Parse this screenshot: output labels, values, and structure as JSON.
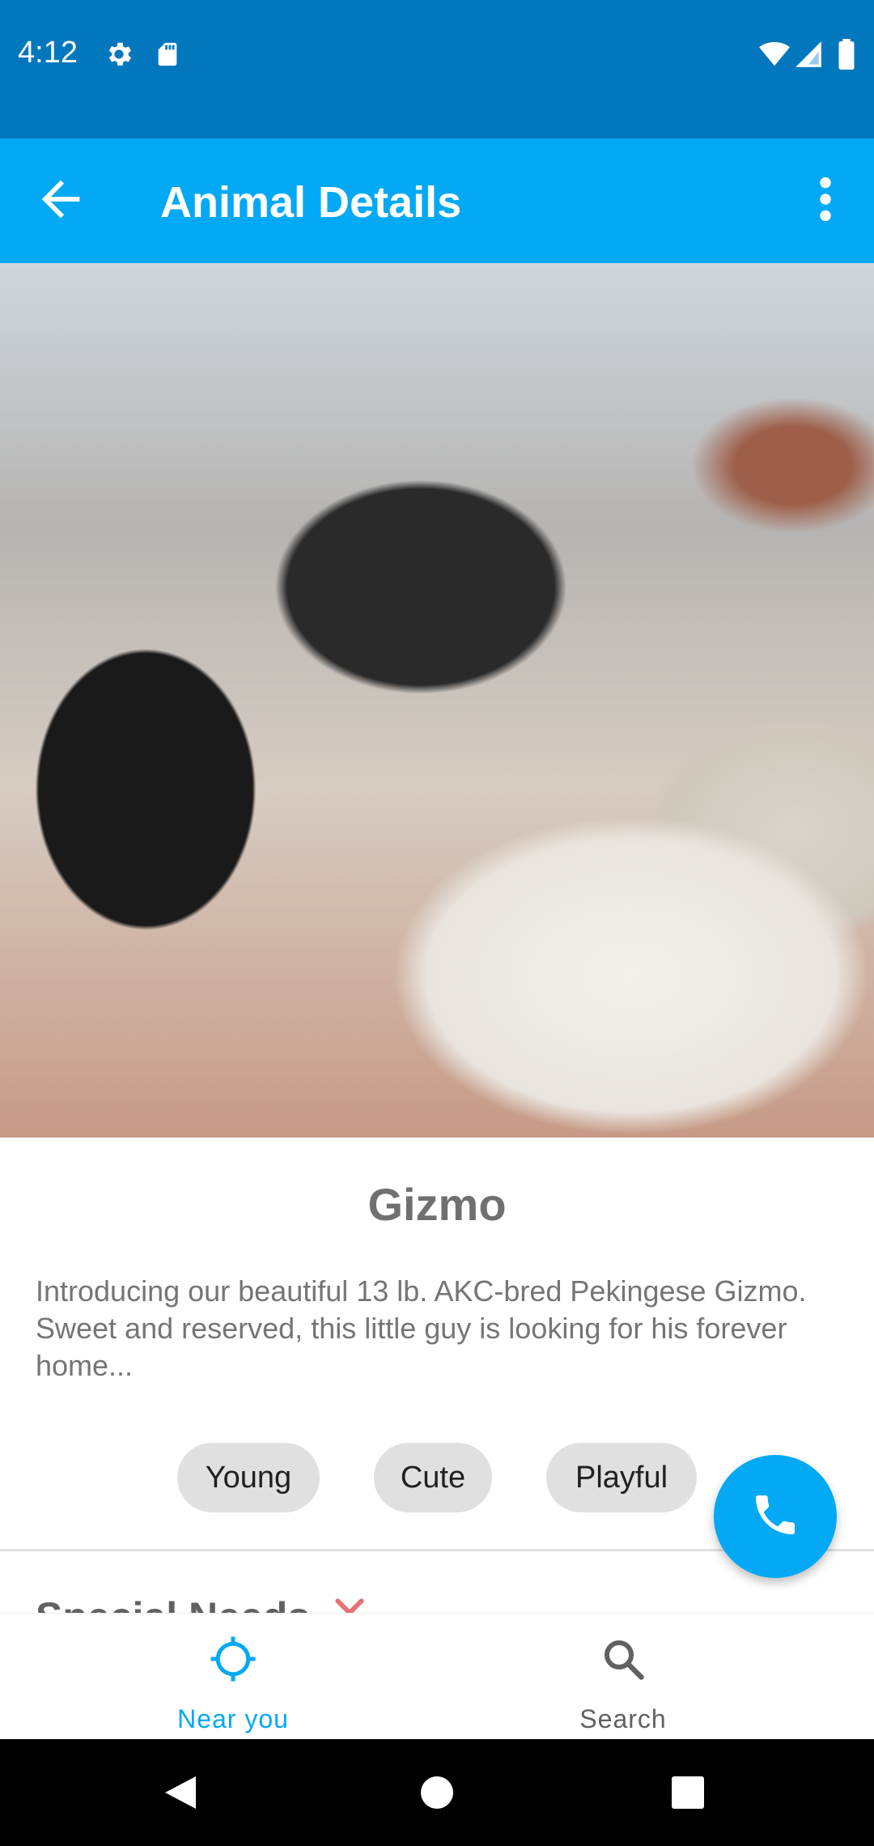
{
  "status_bar": {
    "time": "4:12",
    "icons": [
      "settings-icon",
      "sd-card-icon",
      "wifi-icon",
      "signal-icon",
      "battery-icon"
    ]
  },
  "app_bar": {
    "title": "Animal Details",
    "back_icon": "arrow-back-icon",
    "menu_icon": "more-vert-icon"
  },
  "animal": {
    "name": "Gizmo",
    "description": "Introducing our beautiful 13 lb. AKC-bred Pekingese Gizmo. Sweet and reserved, this little guy is looking for his forever home...",
    "tags": [
      "Young",
      "Cute",
      "Playful"
    ]
  },
  "special_needs": {
    "label": "Special Needs"
  },
  "fab": {
    "icon": "phone-icon"
  },
  "bottom_nav": {
    "items": [
      {
        "label": "Near you",
        "icon": "gps-crosshair-icon",
        "active": true
      },
      {
        "label": "Search",
        "icon": "search-icon",
        "active": false
      }
    ]
  },
  "colors": {
    "status_bar": "#0277bd",
    "app_bar": "#03a9f4",
    "accent": "#03a9f4",
    "chip": "#e0e0e0",
    "reject_x": "#e57373"
  }
}
